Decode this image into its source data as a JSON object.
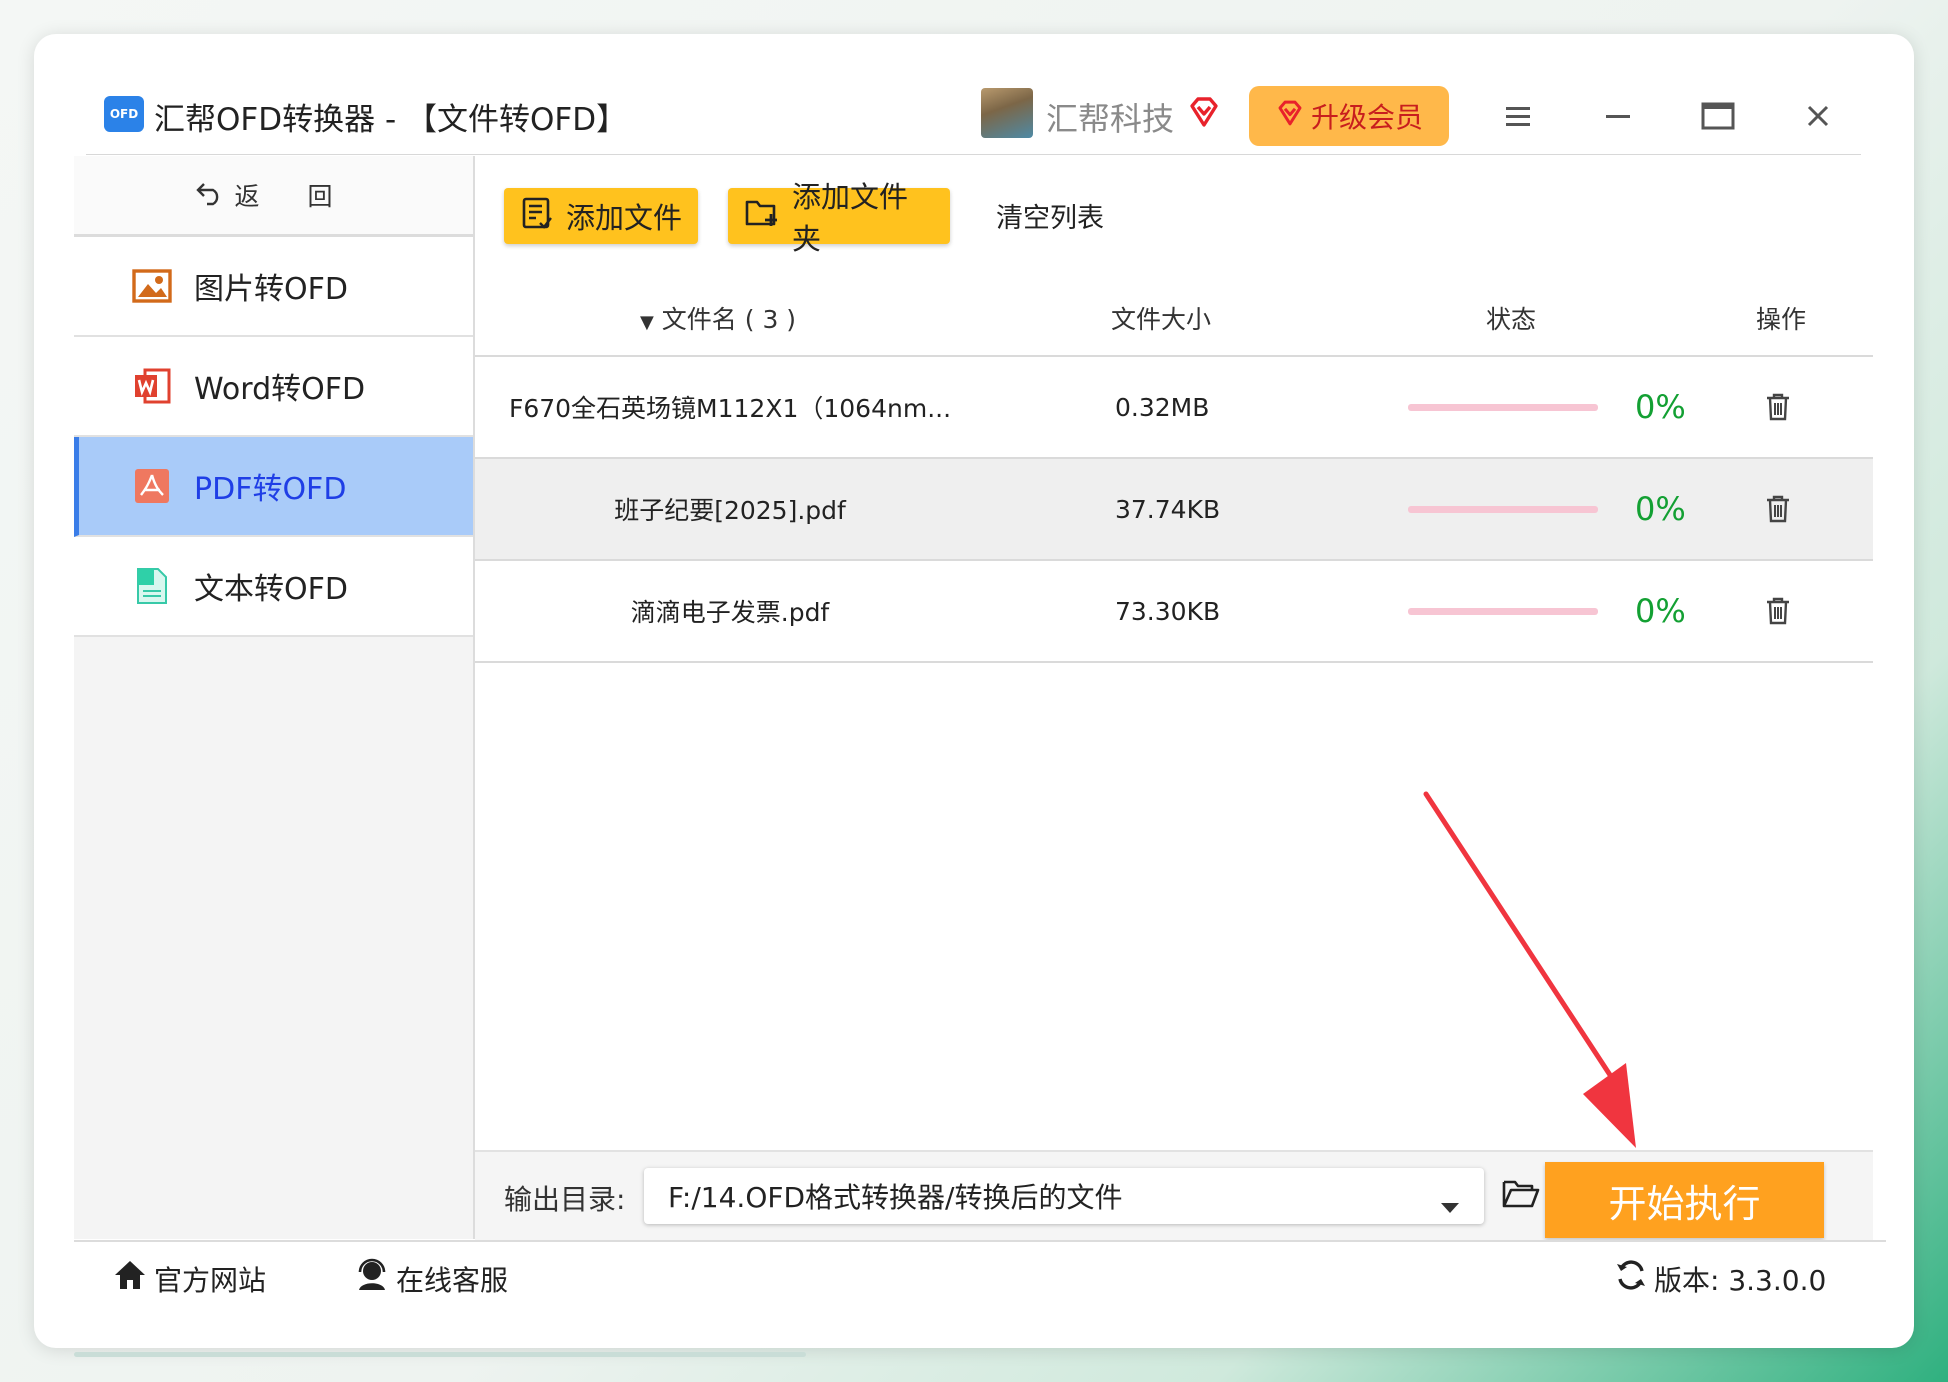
{
  "app": {
    "logo_text": "OFD",
    "title": "汇帮OFD转换器 - 【文件转OFD】",
    "username": "汇帮科技",
    "upgrade_label": "升级会员"
  },
  "sidebar": {
    "back_label": "返 回",
    "items": [
      {
        "label": "图片转OFD",
        "icon": "image-icon"
      },
      {
        "label": "Word转OFD",
        "icon": "word-icon"
      },
      {
        "label": "PDF转OFD",
        "icon": "pdf-icon",
        "active": true
      },
      {
        "label": "文本转OFD",
        "icon": "text-doc-icon"
      }
    ]
  },
  "toolbar": {
    "add_file": "添加文件",
    "add_folder": "添加文件夹",
    "clear_list": "清空列表"
  },
  "table": {
    "headers": {
      "name": "文件名 ( 3 )",
      "size": "文件大小",
      "status": "状态",
      "action": "操作"
    },
    "rows": [
      {
        "name": "F670全石英场镜M112X1（1064nm...",
        "size": "0.32MB",
        "progress": 0,
        "percent": "0%"
      },
      {
        "name": "班子纪要[2025].pdf",
        "size": "37.74KB",
        "progress": 0,
        "percent": "0%"
      },
      {
        "name": "滴滴电子发票.pdf",
        "size": "73.30KB",
        "progress": 0,
        "percent": "0%"
      }
    ]
  },
  "output": {
    "label": "输出目录:",
    "path": "F:/14.OFD格式转换器/转换后的文件",
    "start_label": "开始执行"
  },
  "footer": {
    "website": "官方网站",
    "support": "在线客服",
    "version": "版本:  3.3.0.0"
  },
  "colors": {
    "accent_yellow": "#ffc21e",
    "start_orange": "#ffa11f",
    "active_blue": "#a9cbf9",
    "progress_green": "#13a033",
    "arrow_red": "#f0353f"
  }
}
